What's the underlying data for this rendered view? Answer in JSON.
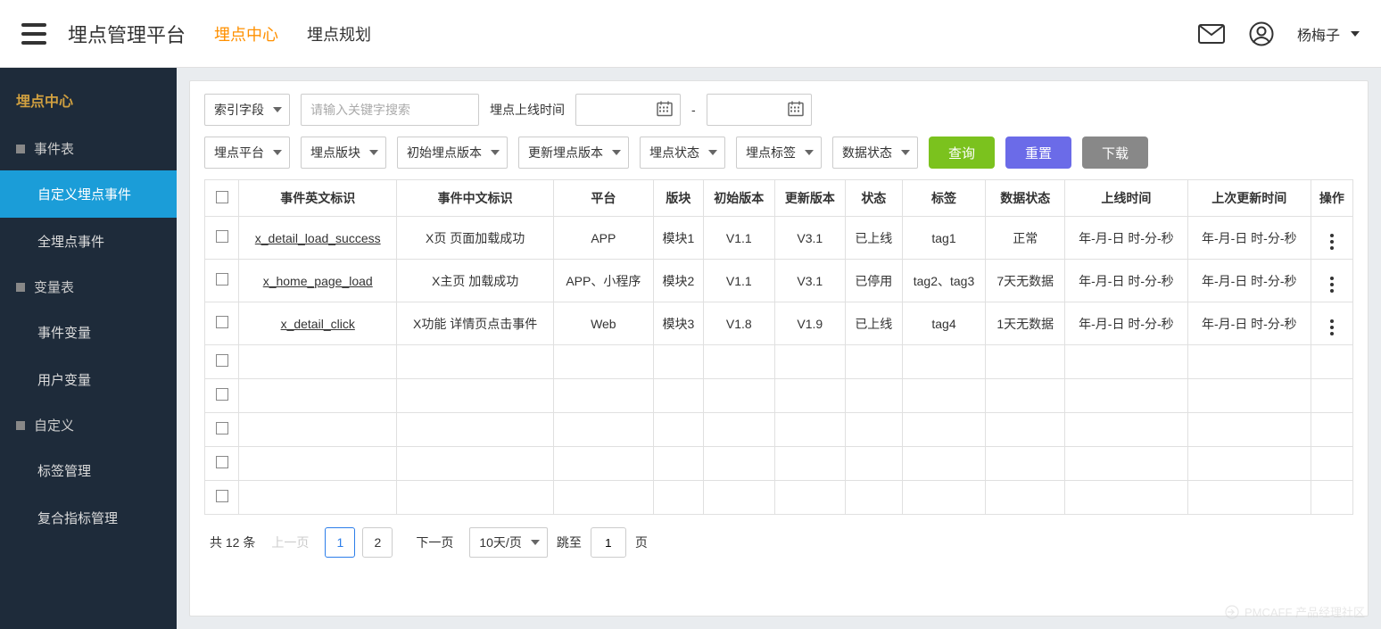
{
  "header": {
    "title": "埋点管理平台",
    "tabs": [
      {
        "label": "埋点中心",
        "active": true
      },
      {
        "label": "埋点规划",
        "active": false
      }
    ],
    "user": "杨梅子"
  },
  "sidebar": {
    "title": "埋点中心",
    "groups": [
      {
        "label": "事件表",
        "items": [
          {
            "label": "自定义埋点事件",
            "active": true
          },
          {
            "label": "全埋点事件",
            "active": false
          }
        ]
      },
      {
        "label": "变量表",
        "items": [
          {
            "label": "事件变量",
            "active": false
          },
          {
            "label": "用户变量",
            "active": false
          }
        ]
      },
      {
        "label": "自定义",
        "items": [
          {
            "label": "标签管理",
            "active": false
          },
          {
            "label": "复合指标管理",
            "active": false
          }
        ]
      }
    ]
  },
  "filters": {
    "index_field": "索引字段",
    "search_placeholder": "请输入关键字搜索",
    "online_time_label": "埋点上线时间",
    "date_sep": "-",
    "platform": "埋点平台",
    "module": "埋点版块",
    "init_version": "初始埋点版本",
    "update_version": "更新埋点版本",
    "status": "埋点状态",
    "tag": "埋点标签",
    "data_status": "数据状态",
    "btn_query": "查询",
    "btn_reset": "重置",
    "btn_download": "下载"
  },
  "table": {
    "columns": [
      "事件英文标识",
      "事件中文标识",
      "平台",
      "版块",
      "初始版本",
      "更新版本",
      "状态",
      "标签",
      "数据状态",
      "上线时间",
      "上次更新时间",
      "操作"
    ],
    "rows": [
      {
        "en": "x_detail_load_success",
        "cn": "X页 页面加载成功",
        "platform": "APP",
        "module": "模块1",
        "init_v": "V1.1",
        "upd_v": "V3.1",
        "status": "已上线",
        "tag": "tag1",
        "data_status": "正常",
        "online_t": "年-月-日 时-分-秒",
        "update_t": "年-月-日 时-分-秒"
      },
      {
        "en": "x_home_page_load",
        "cn": "X主页 加载成功",
        "platform": "APP、小程序",
        "module": "模块2",
        "init_v": "V1.1",
        "upd_v": "V3.1",
        "status": "已停用",
        "tag": "tag2、tag3",
        "data_status": "7天无数据",
        "online_t": "年-月-日 时-分-秒",
        "update_t": "年-月-日 时-分-秒"
      },
      {
        "en": "x_detail_click",
        "cn": "X功能 详情页点击事件",
        "platform": "Web",
        "module": "模块3",
        "init_v": "V1.8",
        "upd_v": "V1.9",
        "status": "已上线",
        "tag": "tag4",
        "data_status": "1天无数据",
        "online_t": "年-月-日 时-分-秒",
        "update_t": "年-月-日 时-分-秒"
      }
    ],
    "empty_rows": 5
  },
  "pagination": {
    "total_prefix": "共 ",
    "total": "12",
    "total_suffix": " 条",
    "prev": "上一页",
    "pages": [
      "1",
      "2"
    ],
    "current": "1",
    "next": "下一页",
    "per_page": "10天/页",
    "jump_label": "跳至",
    "jump_value": "1",
    "jump_suffix": "页"
  },
  "watermark": "PMCAFF 产品经理社区"
}
